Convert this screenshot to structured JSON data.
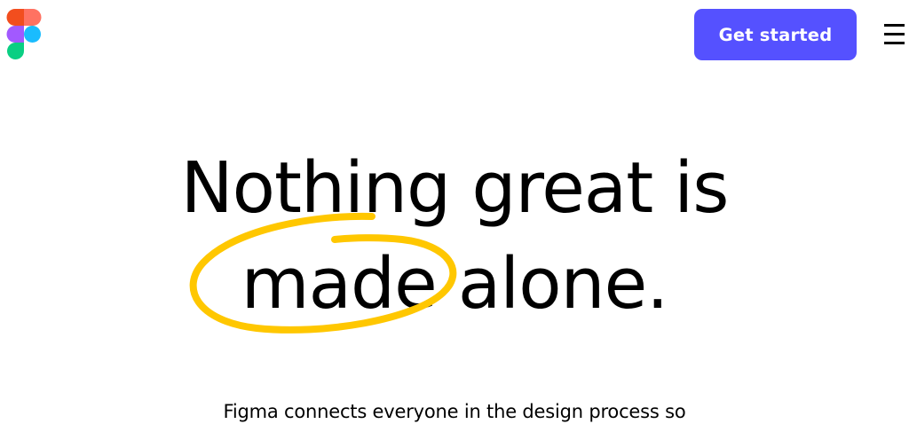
{
  "header": {
    "logo_icon": "figma-logo-icon",
    "cta_label": "Get started",
    "menu_icon": "hamburger-menu-icon"
  },
  "hero": {
    "line1": "Nothing great is",
    "line2": "made alone.",
    "highlight_word": "made"
  },
  "subheading": "Figma connects everyone in the design process so",
  "colors": {
    "cta_background": "#5551ff",
    "highlight_scribble": "#ffc700",
    "logo": [
      "#f24e1e",
      "#ff7262",
      "#a259ff",
      "#1abcfe",
      "#0acf83"
    ]
  }
}
